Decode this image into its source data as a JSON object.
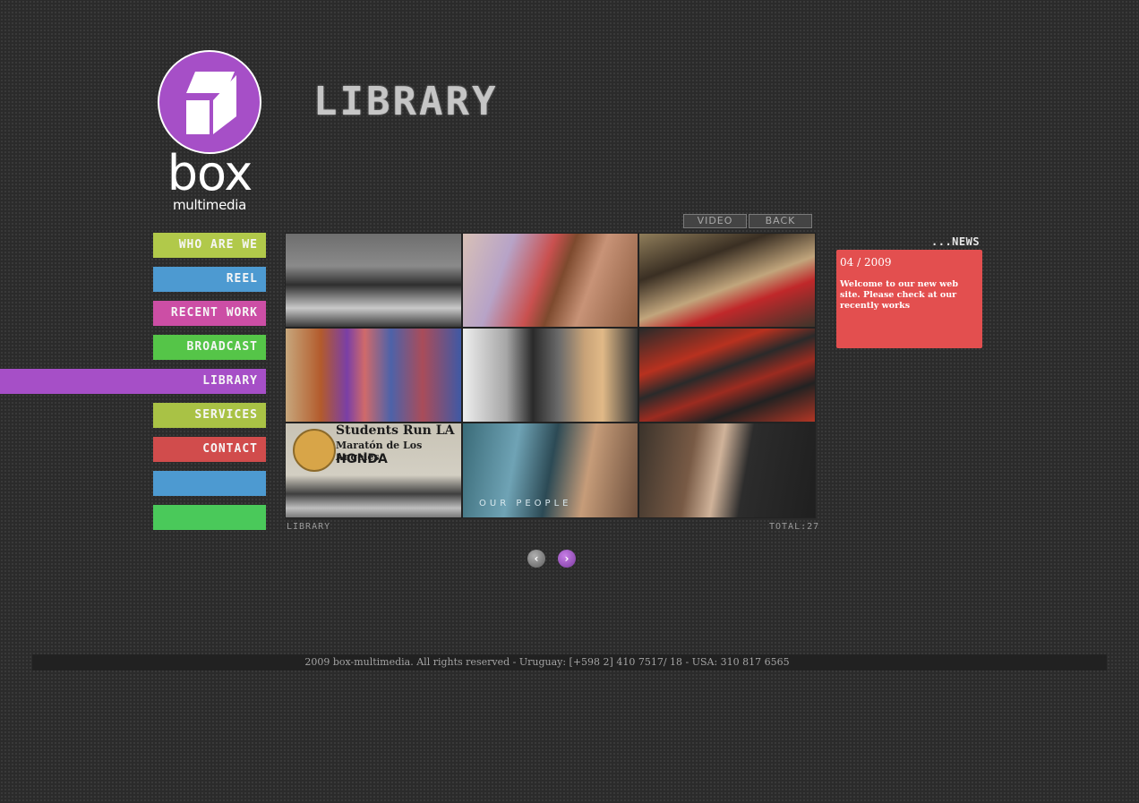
{
  "brand": {
    "name": "box",
    "tagline": "multimedia"
  },
  "page": {
    "title": "LIBRARY"
  },
  "tabs": {
    "video": "VIDEO",
    "back": "BACK"
  },
  "nav": {
    "items": [
      {
        "label": "WHO ARE WE",
        "color": "#b1c94a"
      },
      {
        "label": "REEL",
        "color": "#4d9ad1"
      },
      {
        "label": "RECENT WORK",
        "color": "#cc4ea5"
      },
      {
        "label": "BROADCAST",
        "color": "#55c548"
      },
      {
        "label": "LIBRARY",
        "color": "#a64fc7",
        "active": true
      },
      {
        "label": "SERVICES",
        "color": "#a9c245"
      },
      {
        "label": "CONTACT",
        "color": "#d14c4c"
      },
      {
        "label": "",
        "color": "#4d9ad1"
      },
      {
        "label": "",
        "color": "#4ac95a"
      }
    ]
  },
  "gallery": {
    "caption_left": "LIBRARY",
    "caption_right": "TOTAL:27",
    "thumb7_title": "Students Run LA",
    "thumb7_sub": "Maratón de Los Angeles",
    "thumb7_sponsor": "HONDA",
    "thumb8_text": "OUR PEOPLE"
  },
  "pager": {
    "prev_icon": "chevron-left-icon",
    "next_icon": "chevron-right-icon"
  },
  "news": {
    "heading": "...NEWS",
    "date": "04 / 2009",
    "text": "Welcome to our new web site. Please check at our recently works"
  },
  "footer": {
    "text": "2009 box-multimedia. All rights reserved - Uruguay: [+598 2] 410 7517/ 18  -  USA: 310 817 6565"
  }
}
